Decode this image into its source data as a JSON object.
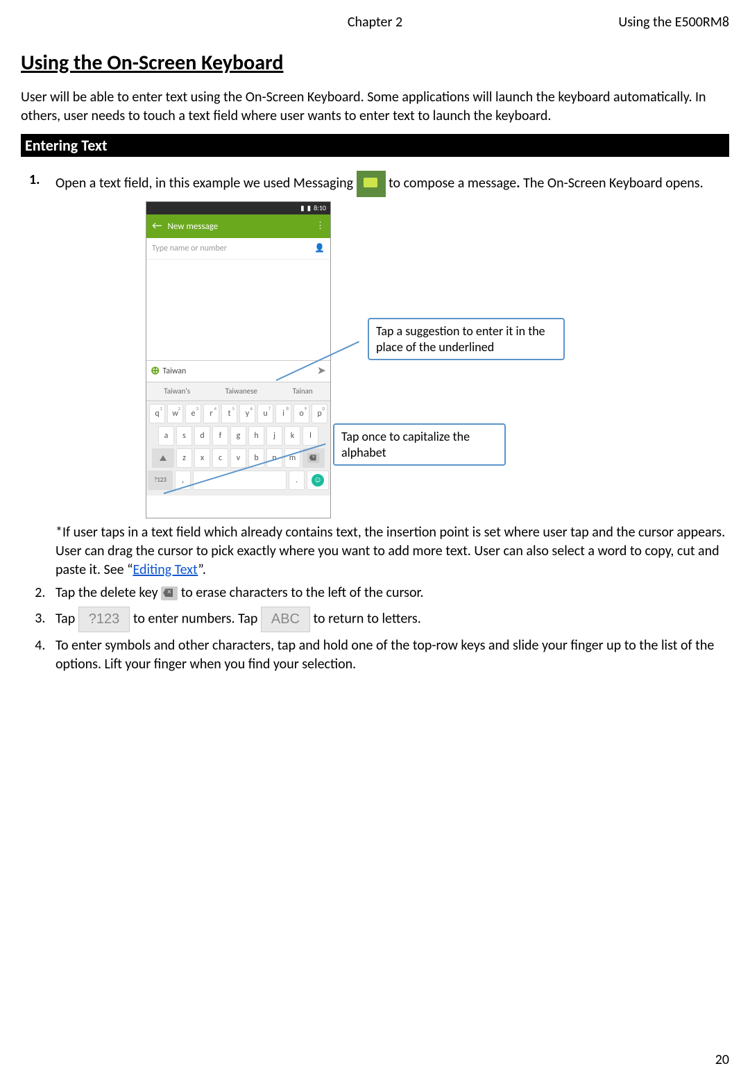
{
  "header": {
    "center": "Chapter 2",
    "right": "Using the E500RM8"
  },
  "title": "Using the On-Screen Keyboard",
  "intro": "User will be able to enter text using the On-Screen Keyboard. Some applications will launch the keyboard automatically. In others, user needs to touch a text field where user wants to enter text to launch the keyboard.",
  "section_bar": "Entering Text",
  "step1_a": "Open a text field, in this example we used Messaging ",
  "step1_b": " to compose a message",
  "step1_c": " The On-Screen Keyboard opens.",
  "phone": {
    "time": "8:10",
    "appbar_title": "New message",
    "to_placeholder": "Type name or number",
    "compose_text": "Taiwan",
    "suggestions": [
      "Taiwan's",
      "Taiwanese",
      "Tainan"
    ],
    "row1": [
      "q",
      "w",
      "e",
      "r",
      "t",
      "y",
      "u",
      "i",
      "o",
      "p"
    ],
    "row1sup": [
      "1",
      "2",
      "3",
      "4",
      "5",
      "6",
      "7",
      "8",
      "9",
      "0"
    ],
    "row2": [
      "a",
      "s",
      "d",
      "f",
      "g",
      "h",
      "j",
      "k",
      "l"
    ],
    "row3": [
      "z",
      "x",
      "c",
      "v",
      "b",
      "n",
      "m"
    ],
    "sym_key": "?123"
  },
  "callout1": "Tap a suggestion to enter it in the place of the underlined",
  "callout2": "Tap once to capitalize the alphabet",
  "note_a": "*If user taps in a text field which already contains text, the insertion point is set where user tap and the cursor appears. User can drag the cursor to pick exactly where you want to add more text. User can also select a word to copy, cut and paste it. See “",
  "note_link": "Editing Text",
  "note_b": "”.",
  "step2_a": "Tap the delete key ",
  "step2_b": " to erase characters to the left of the cursor.",
  "step3_a": "Tap ",
  "step3_key1": "?123",
  "step3_b": " to enter numbers. Tap ",
  "step3_key2": "ABC",
  "step3_c": " to return to letters.",
  "step4": "To enter symbols and other characters, tap and hold one of the top-row keys and slide your finger up to the list of the options. Lift your finger when you find your selection.",
  "page_num": "20"
}
